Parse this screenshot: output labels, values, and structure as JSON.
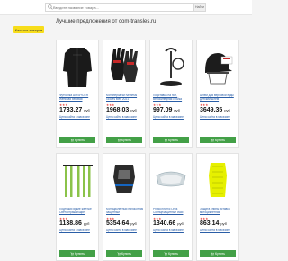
{
  "header": {
    "search_placeholder": "Введите название товара...",
    "search_button": "Найти"
  },
  "sidebar": {
    "catalog_button": "Каталог товаров"
  },
  "main": {
    "title": "Лучшие предложения от com-transles.ru"
  },
  "products": [
    {
      "name": "Футболка AIRSPIDER Женская беговая компрессионная",
      "rating": "★★★",
      "price": "1733.27",
      "currency": "руб",
      "store": "Цена сайта в магазине",
      "buy": "Купить",
      "badge": ""
    },
    {
      "name": "Мотоперчатки Nemesis Gloves Men 2021",
      "rating": "★★★",
      "price": "1968.03",
      "currency": "руб",
      "store": "Цена сайта в магазине",
      "buy": "Купить",
      "badge": ""
    },
    {
      "name": "Подставка на пол, Велосипедная стойка",
      "rating": "★★★",
      "price": "997.09",
      "currency": "руб",
      "store": "Цена сайта в магазине",
      "buy": "Купить",
      "badge": ""
    },
    {
      "name": "Шлем для верховой езды Детский шлем",
      "rating": "★★★",
      "price": "3649.35",
      "currency": "руб",
      "store": "Цена сайта в магазине",
      "buy": "Купить",
      "badge": ""
    },
    {
      "name": "Подтяжки яркие желтые Светоотражающие",
      "rating": "★★★",
      "price": "1138.86",
      "currency": "руб",
      "store": "Цена сайта в магазине",
      "buy": "Купить",
      "badge": ""
    },
    {
      "name": "Мотоциклетный налокотник защитный",
      "rating": "★★★",
      "price": "5354.64",
      "currency": "руб",
      "store": "Цена сайта в магазине",
      "buy": "Купить",
      "badge": ""
    },
    {
      "name": "Photochromic Lens Солнцезащитные очки",
      "rating": "★★★",
      "price": "1340.66",
      "currency": "руб",
      "store": "Цена сайта в магазине",
      "buy": "Купить",
      "badge": ""
    },
    {
      "name": "Защита спины вставка мотоциклетная",
      "rating": "★★★",
      "price": "863.14",
      "currency": "руб",
      "store": "Цена сайта в магазине",
      "buy": "Купить",
      "badge": ""
    }
  ],
  "colors": {
    "accent": "#f7dd1a",
    "buy": "#43a047",
    "link": "#2a5ea7"
  }
}
